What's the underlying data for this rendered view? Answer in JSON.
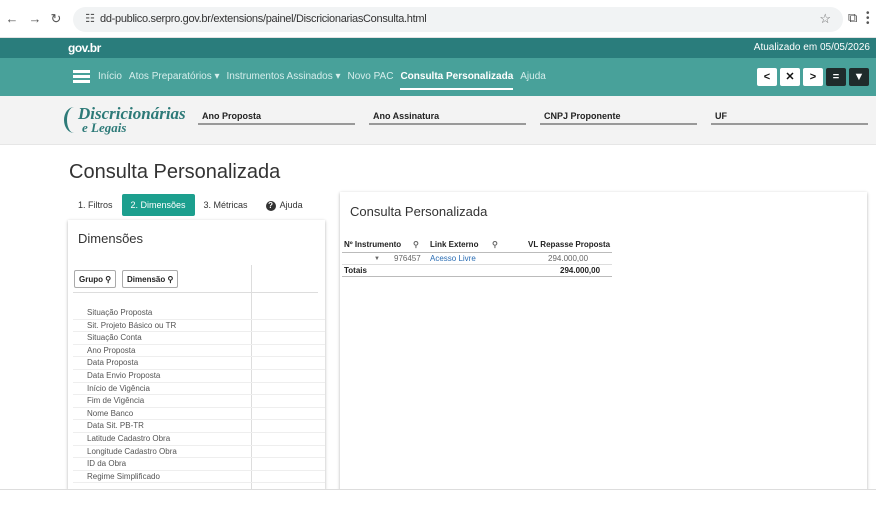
{
  "browser": {
    "url": "dd-publico.serpro.gov.br/extensions/painel/DiscricionariasConsulta.html",
    "back_icon": "arrow-left-icon",
    "forward_icon": "arrow-right-icon",
    "reload_icon": "reload-icon"
  },
  "gov": {
    "logo": "gov.br",
    "updated": "Atualizado em 05/05/2026"
  },
  "nav": {
    "items": [
      {
        "label": "Início"
      },
      {
        "label": "Atos Preparatórios ▾"
      },
      {
        "label": "Instrumentos Assinados ▾"
      },
      {
        "label": "Novo PAC"
      },
      {
        "label": "Consulta Personalizada"
      },
      {
        "label": "Ajuda"
      }
    ],
    "tools": [
      {
        "glyph": "<",
        "name": "back"
      },
      {
        "glyph": "✕",
        "name": "clear"
      },
      {
        "glyph": ">",
        "name": "forward"
      },
      {
        "glyph": "=",
        "name": "menu"
      },
      {
        "glyph": "▼",
        "name": "filter"
      }
    ]
  },
  "brand": {
    "main": "Discricionárias",
    "sub": "e Legais"
  },
  "filters": [
    {
      "label": "Ano Proposta"
    },
    {
      "label": "Ano Assinatura"
    },
    {
      "label": "CNPJ Proponente"
    },
    {
      "label": "UF"
    }
  ],
  "page": {
    "title": "Consulta Personalizada",
    "tabs": [
      {
        "label": "1. Filtros"
      },
      {
        "label": "2. Dimensões"
      },
      {
        "label": "3. Métricas"
      },
      {
        "label": "Ajuda"
      }
    ]
  },
  "dimensions": {
    "title": "Dimensões",
    "group_label": "Grupo",
    "dimension_label": "Dimensão",
    "items": [
      "Situação Proposta",
      "Sit. Projeto Básico ou TR",
      "Situação Conta",
      "Ano Proposta",
      "Data Proposta",
      "Data Envio Proposta",
      "Início de Vigência",
      "Fim de Vigência",
      "Nome Banco",
      "Data Sit. PB-TR",
      "Latitude Cadastro Obra",
      "Longitude Cadastro Obra",
      "ID da Obra",
      "Regime Simplificado"
    ]
  },
  "result": {
    "title": "Consulta Personalizada",
    "headers": {
      "instrumento": "Nº Instrumento",
      "link": "Link Externo",
      "valor": "VL Repasse Proposta"
    },
    "row": {
      "instrumento": "976457",
      "link": "Acesso Livre",
      "valor": "294.000,00"
    },
    "totals": {
      "label": "Totais",
      "valor": "294.000,00"
    }
  }
}
